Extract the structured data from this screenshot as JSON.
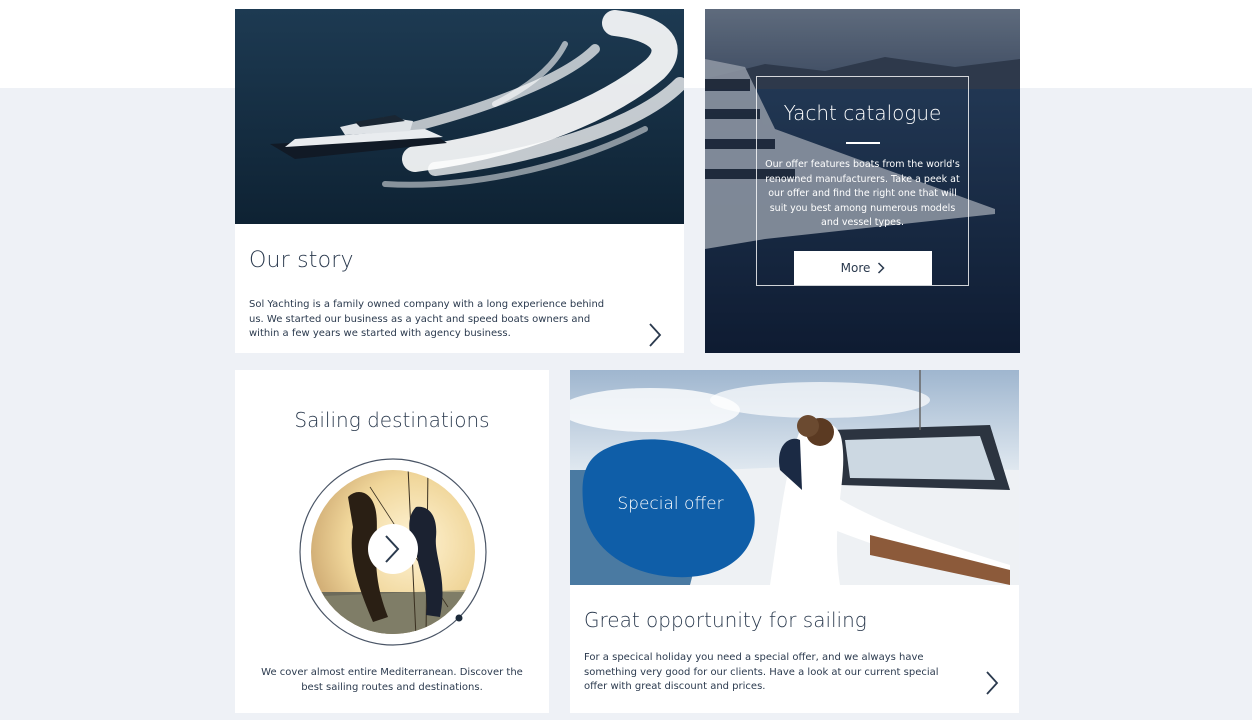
{
  "story": {
    "title": "Our story",
    "text": "Sol Yachting is a family owned company with a long experience behind us. We started our business as a yacht and speed boats owners and within a few years we started with agency business."
  },
  "catalogue": {
    "title": "Yacht catalogue",
    "text": "Our offer features boats from the world's renowned manufacturers. Take a peek at our offer and find the right one that will suit you best among numerous models and vessel types.",
    "button_label": "More"
  },
  "destinations": {
    "title": "Sailing destinations",
    "text": "We cover almost entire Mediterranean. Discover the best sailing routes and destinations."
  },
  "offer": {
    "badge_label": "Special offer",
    "title": "Great opportunity for sailing",
    "text": "For a specical holiday you need a special offer, and we always have something very good for our clients. Have a look at our current special offer with great discount and prices."
  },
  "colors": {
    "page_background": "#eef1f6",
    "text": "#2b3a4e",
    "offer_blob": "#0f5ea8",
    "catalogue_overlay": "#13223c"
  },
  "icons": {
    "story_arrow": "chevron-right-icon",
    "more_arrow": "chevron-right-icon",
    "destinations_arrow": "chevron-right-icon",
    "offer_arrow": "chevron-right-icon"
  }
}
